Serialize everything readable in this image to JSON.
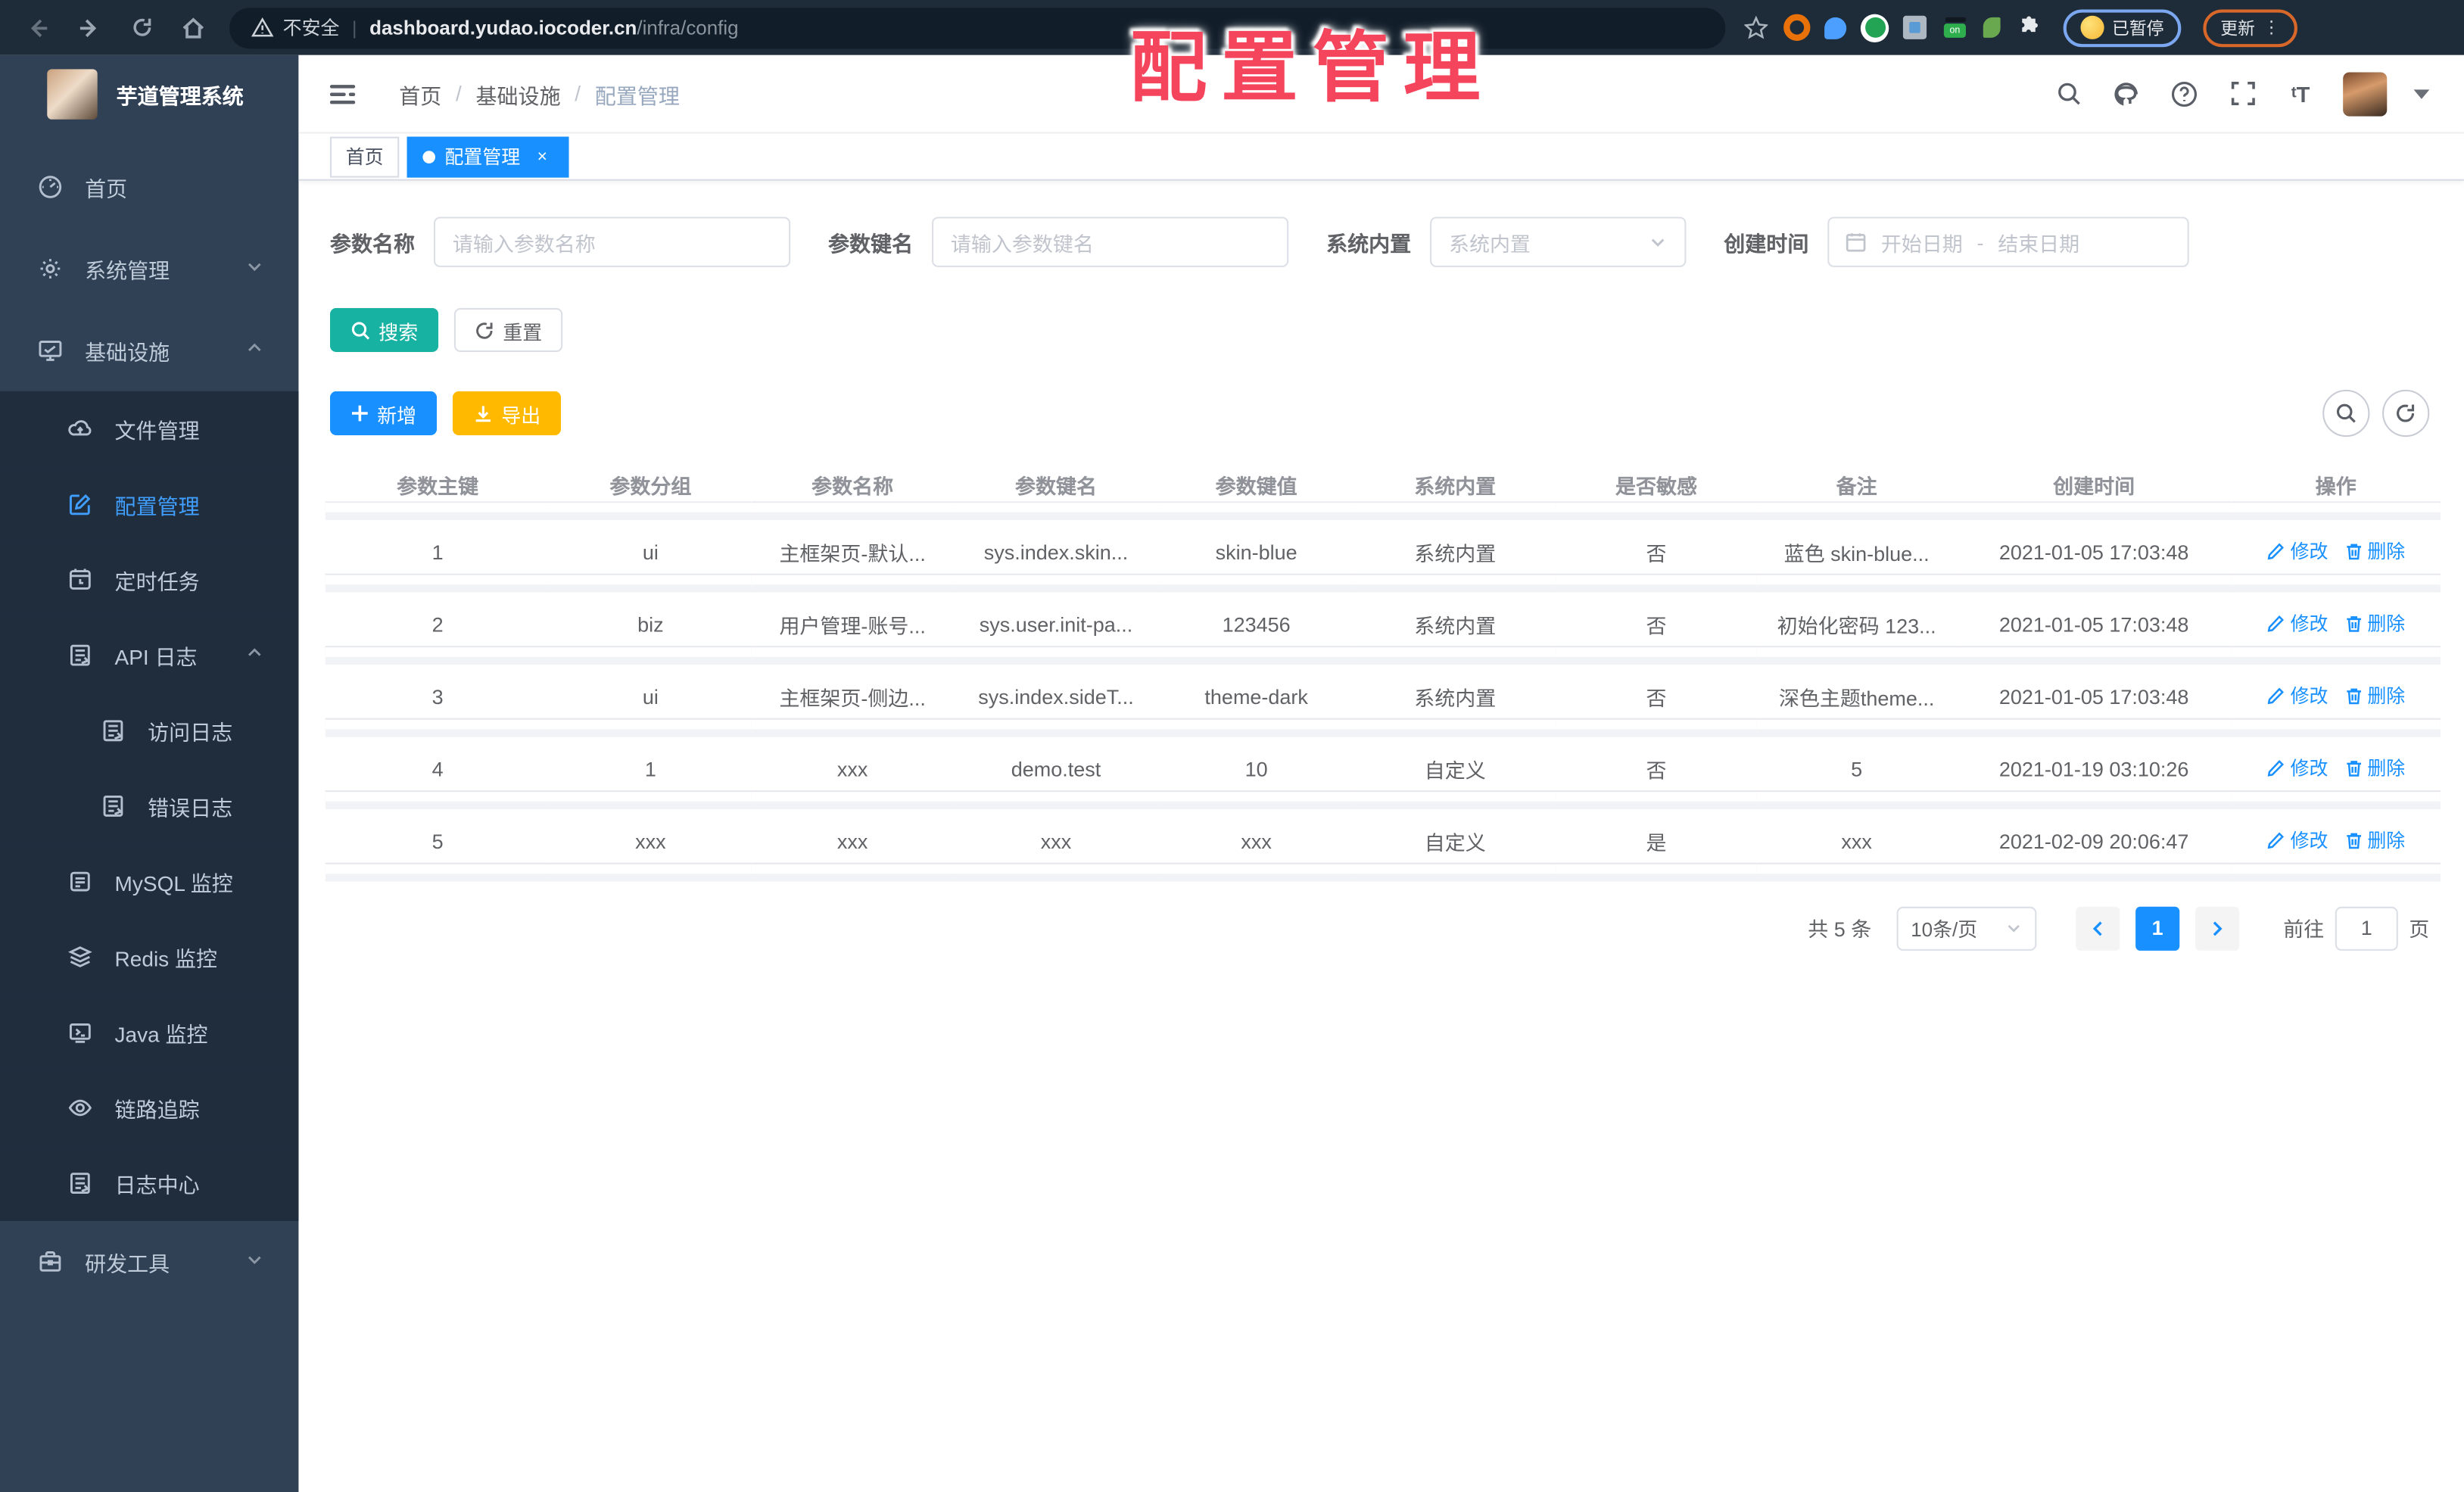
{
  "browser": {
    "security_label": "不安全",
    "url_host": "dashboard.yudao.iocoder.cn",
    "url_path": "/infra/config",
    "paused_badge": "已暂停",
    "update_button": "更新"
  },
  "overlay_title": "配置管理",
  "sidebar": {
    "app_title": "芋道管理系统",
    "menu": [
      {
        "id": "home",
        "label": "首页",
        "icon": "dashboard-icon",
        "level": 0
      },
      {
        "id": "system",
        "label": "系统管理",
        "icon": "gear-icon",
        "level": 0,
        "chevron": "down"
      },
      {
        "id": "infra",
        "label": "基础设施",
        "icon": "monitor-icon",
        "level": 0,
        "chevron": "up"
      },
      {
        "id": "files",
        "label": "文件管理",
        "icon": "cloud-icon",
        "level": 1
      },
      {
        "id": "config",
        "label": "配置管理",
        "icon": "edit-icon",
        "level": 1,
        "active": true
      },
      {
        "id": "jobs",
        "label": "定时任务",
        "icon": "timer-icon",
        "level": 1
      },
      {
        "id": "api-log",
        "label": "API 日志",
        "icon": "log-icon",
        "level": 1,
        "chevron": "up"
      },
      {
        "id": "access-log",
        "label": "访问日志",
        "icon": "log-icon",
        "level": 2
      },
      {
        "id": "error-log",
        "label": "错误日志",
        "icon": "log-icon",
        "level": 2
      },
      {
        "id": "mysql",
        "label": "MySQL 监控",
        "icon": "database-icon",
        "level": 1
      },
      {
        "id": "redis",
        "label": "Redis 监控",
        "icon": "stack-icon",
        "level": 1
      },
      {
        "id": "java",
        "label": "Java 监控",
        "icon": "java-icon",
        "level": 1
      },
      {
        "id": "trace",
        "label": "链路追踪",
        "icon": "eye-icon",
        "level": 1
      },
      {
        "id": "log-center",
        "label": "日志中心",
        "icon": "log-icon",
        "level": 1
      },
      {
        "id": "dev-tools",
        "label": "研发工具",
        "icon": "toolbox-icon",
        "level": 0,
        "chevron": "down"
      }
    ]
  },
  "header": {
    "breadcrumb": [
      "首页",
      "基础设施",
      "配置管理"
    ]
  },
  "tabs": [
    {
      "label": "首页",
      "active": false
    },
    {
      "label": "配置管理",
      "active": true,
      "closable": true
    }
  ],
  "filters": {
    "name": {
      "label": "参数名称",
      "placeholder": "请输入参数名称"
    },
    "key": {
      "label": "参数键名",
      "placeholder": "请输入参数键名"
    },
    "builtin": {
      "label": "系统内置",
      "placeholder": "系统内置"
    },
    "time": {
      "label": "创建时间",
      "start": "开始日期",
      "sep": "-",
      "end": "结束日期"
    }
  },
  "toolbar": {
    "search": "搜索",
    "reset": "重置",
    "add": "新增",
    "export": "导出"
  },
  "table": {
    "headers": [
      "参数主键",
      "参数分组",
      "参数名称",
      "参数键名",
      "参数键值",
      "系统内置",
      "是否敏感",
      "备注",
      "创建时间",
      "操作"
    ],
    "rows": [
      [
        "1",
        "ui",
        "主框架页-默认...",
        "sys.index.skin...",
        "skin-blue",
        "系统内置",
        "否",
        "蓝色 skin-blue...",
        "2021-01-05 17:03:48"
      ],
      [
        "2",
        "biz",
        "用户管理-账号...",
        "sys.user.init-pa...",
        "123456",
        "系统内置",
        "否",
        "初始化密码 123...",
        "2021-01-05 17:03:48"
      ],
      [
        "3",
        "ui",
        "主框架页-侧边...",
        "sys.index.sideT...",
        "theme-dark",
        "系统内置",
        "否",
        "深色主题theme...",
        "2021-01-05 17:03:48"
      ],
      [
        "4",
        "1",
        "xxx",
        "demo.test",
        "10",
        "自定义",
        "否",
        "5",
        "2021-01-19 03:10:26"
      ],
      [
        "5",
        "xxx",
        "xxx",
        "xxx",
        "xxx",
        "自定义",
        "是",
        "xxx",
        "2021-02-09 20:06:47"
      ]
    ],
    "edit_label": "修改",
    "delete_label": "删除"
  },
  "pagination": {
    "total": "共 5 条",
    "page_size": "10条/页",
    "current_page": "1",
    "goto_label": "前往",
    "page_unit": "页"
  },
  "colors": {
    "accent": "#1890ff",
    "success": "#18b2a2",
    "warning": "#ffba00",
    "sidebar_bg": "#304156",
    "submenu_bg": "#1f2d3d",
    "active_menu_text": "#409eff",
    "overlay_text": "#f5455c",
    "chrome_bg": "#1e2b39"
  }
}
